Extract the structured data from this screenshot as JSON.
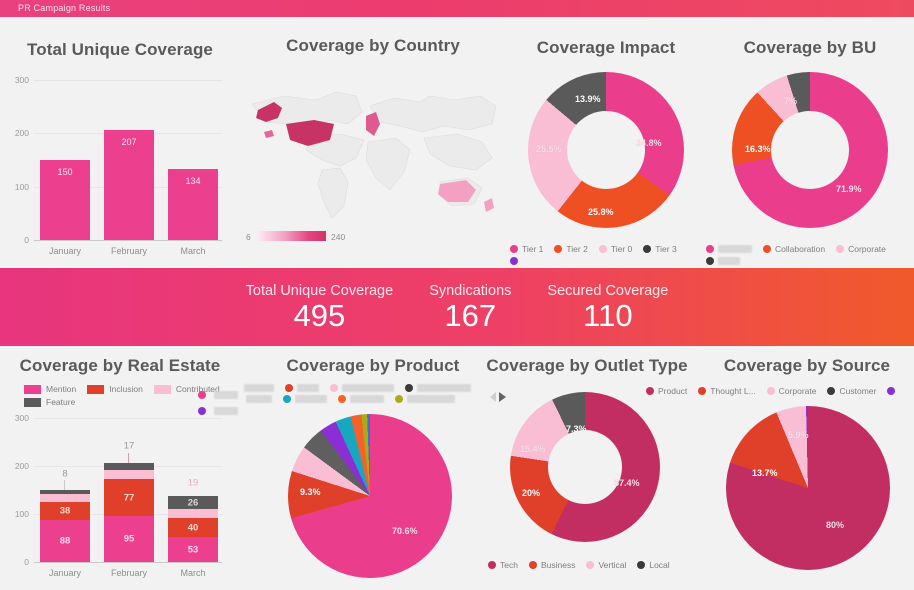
{
  "header": {
    "title": "PR Campaign Results"
  },
  "colors": {
    "pink": "#ea3d8c",
    "pink_bar": "#ec3f8d",
    "red": "#e0402a",
    "light_pink": "#f9bdd4",
    "dark_gray": "#5a5a5a",
    "purple": "#8b2fd4",
    "magenta_dark": "#c32e62",
    "teal": "#17a8c0",
    "olive": "#a9ac16",
    "orange": "#f4622a",
    "gray_slice": "#5f5f5f",
    "blue": "#3c6fd0",
    "accent_banner_left": "#e8357e",
    "accent_banner_right": "#f05a2a"
  },
  "panels": {
    "total_unique_coverage": {
      "title": "Total Unique Coverage"
    },
    "coverage_by_country": {
      "title": "Coverage by Country"
    },
    "coverage_impact": {
      "title": "Coverage Impact"
    },
    "coverage_by_bu": {
      "title": "Coverage by BU"
    },
    "coverage_by_real_estate": {
      "title": "Coverage by Real Estate"
    },
    "coverage_by_product": {
      "title": "Coverage by Product"
    },
    "coverage_by_outlet_type": {
      "title": "Coverage by Outlet Type"
    },
    "coverage_by_source": {
      "title": "Coverage by Source"
    }
  },
  "kpis": [
    {
      "label": "Total Unique Coverage",
      "value": "495"
    },
    {
      "label": "Syndications",
      "value": "167"
    },
    {
      "label": "Secured Coverage",
      "value": "110"
    }
  ],
  "map": {
    "legend_min": "6",
    "legend_max": "240",
    "regions": [
      {
        "name": "United States",
        "intensity": "high"
      },
      {
        "name": "United Kingdom",
        "intensity": "medium"
      },
      {
        "name": "Australia",
        "intensity": "low"
      },
      {
        "name": "New Zealand",
        "intensity": "low"
      }
    ]
  },
  "chart_data": [
    {
      "type": "bar",
      "title": "Total Unique Coverage",
      "categories": [
        "January",
        "February",
        "March"
      ],
      "values": [
        150,
        207,
        134
      ],
      "value_labels": [
        "150",
        "207",
        "134"
      ],
      "ylim": [
        0,
        300
      ],
      "yticks": [
        "0",
        "100",
        "200",
        "300"
      ],
      "xlabel": "",
      "ylabel": "",
      "grid": true
    },
    {
      "type": "pie",
      "title": "Coverage Impact",
      "donut": true,
      "labels": [
        "Tier 1",
        "Tier 2",
        "Tier 0",
        "Tier 3"
      ],
      "values": [
        34.8,
        25.8,
        25.5,
        13.9
      ],
      "value_labels": [
        "34.8%",
        "25.8%",
        "25.5%",
        "13.9%"
      ],
      "colors": [
        "#ea3d8c",
        "#ef5023",
        "#f9bdd4",
        "#5a5a5a"
      ],
      "legend": [
        "Tier 1",
        "Tier 2",
        "Tier 0",
        "Tier 3",
        ""
      ],
      "legend_position": "bottom"
    },
    {
      "type": "pie",
      "title": "Coverage by BU",
      "donut": true,
      "labels": [
        "",
        "Collaboration",
        "Corporate",
        ""
      ],
      "values": [
        71.9,
        16.3,
        7.0,
        4.8
      ],
      "value_labels": [
        "71.9%",
        "16.3%",
        "7%",
        ""
      ],
      "colors": [
        "#ea3d8c",
        "#ef5023",
        "#f9bdd4",
        "#5a5a5a"
      ],
      "legend": [
        "",
        "Collaboration",
        "Corporate",
        ""
      ],
      "legend_position": "bottom"
    },
    {
      "type": "bar",
      "title": "Coverage by Real Estate",
      "stacked": true,
      "categories": [
        "January",
        "February",
        "March"
      ],
      "series": [
        {
          "name": "Mention",
          "values": [
            88,
            95,
            53
          ],
          "color": "#ec3f8d"
        },
        {
          "name": "Inclusion",
          "values": [
            38,
            77,
            40
          ],
          "color": "#e0402a"
        },
        {
          "name": "Contributed",
          "values": [
            16,
            18,
            19
          ],
          "color": "#f9bdd4"
        },
        {
          "name": "Feature",
          "values": [
            8,
            17,
            26
          ],
          "color": "#5a5a5a"
        }
      ],
      "ylim": [
        0,
        300
      ],
      "yticks": [
        "0",
        "100",
        "200",
        "300"
      ],
      "legend": [
        "Mention",
        "Inclusion",
        "Contributed",
        "Feature"
      ],
      "legend_position": "top"
    },
    {
      "type": "pie",
      "title": "Coverage by Product",
      "donut": false,
      "labels": [
        "",
        "",
        "",
        "",
        "",
        "",
        "",
        ""
      ],
      "values": [
        70.6,
        9.3,
        5.2,
        4.6,
        3.4,
        3.1,
        2.1,
        1.7
      ],
      "value_labels": [
        "70.6%",
        "9.3%",
        "",
        "",
        "",
        "",
        "",
        ""
      ],
      "colors": [
        "#ea3d8c",
        "#e0402a",
        "#f9bdd4",
        "#5f5f5f",
        "#8b2fd4",
        "#17a8c0",
        "#f4622a",
        "#a9ac16"
      ],
      "legend_position": "top"
    },
    {
      "type": "pie",
      "title": "Coverage by Outlet Type",
      "donut": true,
      "labels": [
        "Tech",
        "Business",
        "Vertical",
        "Local"
      ],
      "values": [
        57.4,
        20.0,
        15.4,
        7.3
      ],
      "value_labels": [
        "57.4%",
        "20%",
        "15.4%",
        "7.3%"
      ],
      "colors": [
        "#c32e62",
        "#e0402a",
        "#f9bdd4",
        "#5a5a5a"
      ],
      "legend": [
        "Tech",
        "Business",
        "Vertical",
        "Local"
      ],
      "legend_position": "bottom"
    },
    {
      "type": "pie",
      "title": "Coverage by Source",
      "donut": false,
      "labels": [
        "Product",
        "Thought L...",
        "Corporate",
        "Customer"
      ],
      "values": [
        80.0,
        13.7,
        5.9,
        0.4
      ],
      "value_labels": [
        "80%",
        "13.7%",
        "5.9%",
        ""
      ],
      "colors": [
        "#c32e62",
        "#e0402a",
        "#f9bdd4",
        "#8b2fd4"
      ],
      "legend": [
        "Product",
        "Thought L...",
        "Corporate",
        "Customer",
        ""
      ],
      "legend_position": "top"
    }
  ],
  "legends": {
    "impact": [
      {
        "label": "Tier 1",
        "color": "#ea3d8c"
      },
      {
        "label": "Tier 2",
        "color": "#ef5023"
      },
      {
        "label": "Tier 0",
        "color": "#f9bdd4"
      },
      {
        "label": "Tier 3",
        "color": "#3a3a3a"
      },
      {
        "label": "",
        "color": "#8b2fd4"
      }
    ],
    "bu": [
      {
        "label": "",
        "color": "#ea3d8c"
      },
      {
        "label": "Collaboration",
        "color": "#ef5023"
      },
      {
        "label": "Corporate",
        "color": "#f9bdd4"
      },
      {
        "label": "",
        "color": "#3a3a3a"
      }
    ],
    "real_estate": [
      {
        "label": "Mention",
        "color": "#ec3f8d"
      },
      {
        "label": "Inclusion",
        "color": "#e0402a"
      },
      {
        "label": "Contributed",
        "color": "#f9bdd4"
      },
      {
        "label": "Feature",
        "color": "#5a5a5a"
      }
    ],
    "product": [
      {
        "label": "",
        "color": "#e0402a"
      },
      {
        "label": "",
        "color": "#f9bdd4"
      },
      {
        "label": "",
        "color": "#3a3a3a"
      },
      {
        "label": "",
        "color": "#17a8c0"
      },
      {
        "label": "",
        "color": "#f4622a"
      },
      {
        "label": "",
        "color": "#a9ac16"
      }
    ],
    "outlet_type": [
      {
        "label": "Tech",
        "color": "#c32e62"
      },
      {
        "label": "Business",
        "color": "#e0402a"
      },
      {
        "label": "Vertical",
        "color": "#f9bdd4"
      },
      {
        "label": "Local",
        "color": "#3a3a3a"
      }
    ],
    "source": [
      {
        "label": "Product",
        "color": "#c32e62"
      },
      {
        "label": "Thought L...",
        "color": "#e0402a"
      },
      {
        "label": "Corporate",
        "color": "#f9bdd4"
      },
      {
        "label": "Customer",
        "color": "#3a3a3a"
      },
      {
        "label": "",
        "color": "#8b2fd4"
      }
    ]
  },
  "controls": {
    "prev_label": "previous",
    "next_label": "next"
  }
}
